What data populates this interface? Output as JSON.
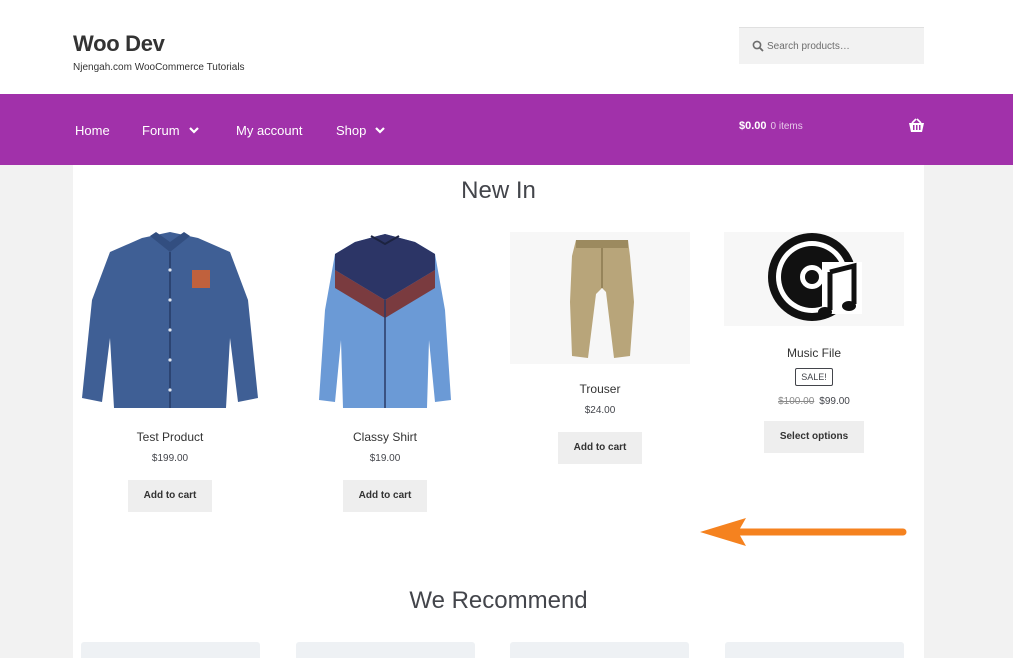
{
  "header": {
    "site_title": "Woo Dev",
    "site_description": "Njengah.com WooCommerce Tutorials",
    "search_placeholder": "Search products…",
    "search_icon": "search-icon"
  },
  "nav": {
    "items": [
      {
        "label": "Home",
        "has_dropdown": false
      },
      {
        "label": "Forum",
        "has_dropdown": true
      },
      {
        "label": "My account",
        "has_dropdown": false
      },
      {
        "label": "Shop",
        "has_dropdown": true
      }
    ],
    "cart_total": "$0.00",
    "cart_count": "0 items",
    "cart_icon": "basket-icon"
  },
  "colors": {
    "nav_background": "#a131aa",
    "annotation_arrow": "#f5821f"
  },
  "sections": {
    "new_in": {
      "title": "New In",
      "products": [
        {
          "name": "Test Product",
          "price": "$199.00",
          "button": "Add to cart",
          "image": "blue-shirt"
        },
        {
          "name": "Classy Shirt",
          "price": "$19.00",
          "button": "Add to cart",
          "image": "chevron-shirt"
        },
        {
          "name": "Trouser",
          "price": "$24.00",
          "button": "Add to cart",
          "image": "khaki-trouser"
        },
        {
          "name": "Music File",
          "badge": "SALE!",
          "old_price": "$100.00",
          "price": "$99.00",
          "button": "Select options",
          "image": "music-disc-icon"
        }
      ]
    },
    "we_recommend": {
      "title": "We Recommend"
    }
  }
}
